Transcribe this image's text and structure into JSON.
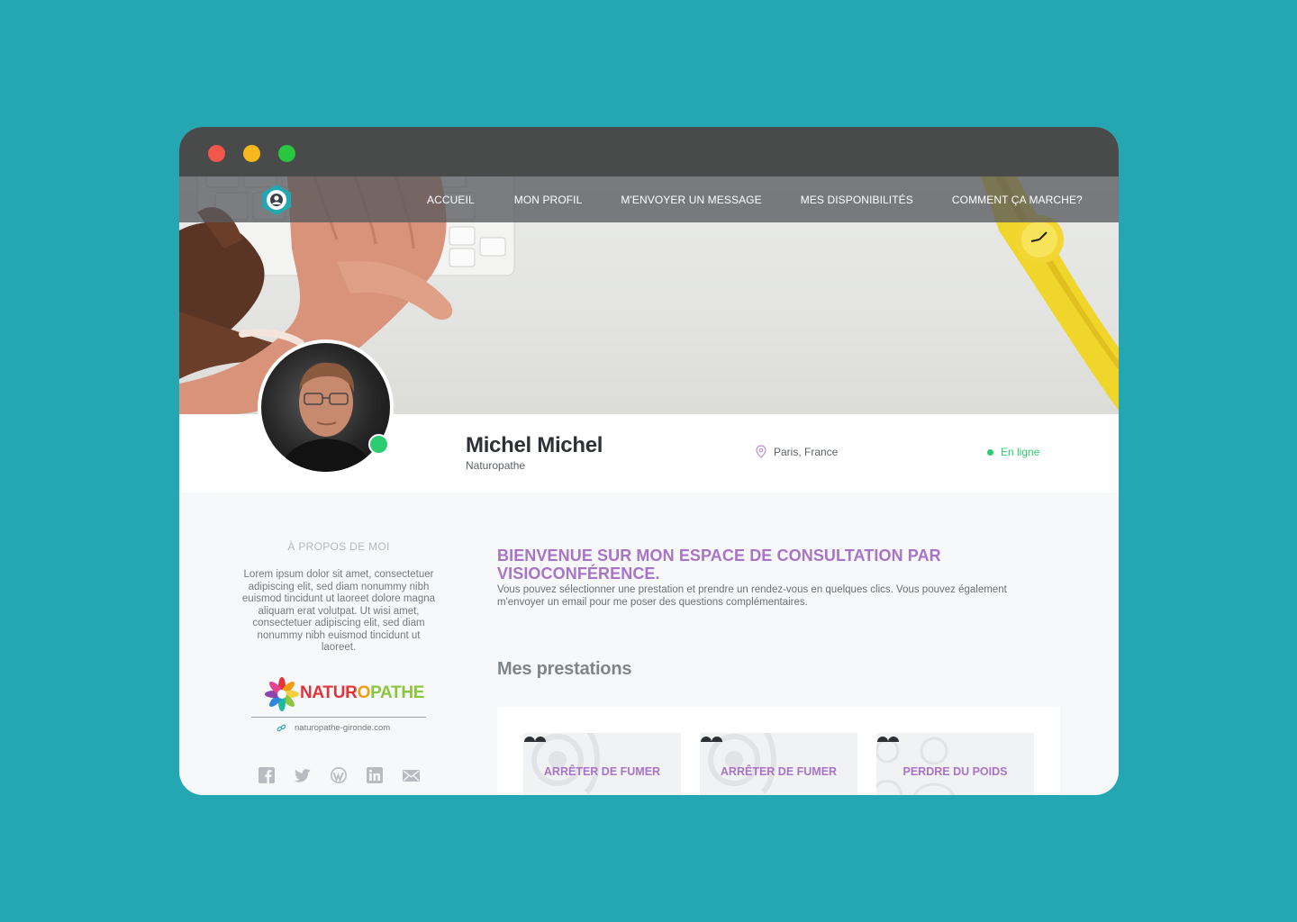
{
  "window": {
    "controls": [
      "close",
      "minimize",
      "maximize"
    ]
  },
  "nav": {
    "logo": "brand-logo-icon",
    "links": [
      "ACCUEIL",
      "MON PROFIL",
      "M'ENVOYER UN MESSAGE",
      "MES DISPONIBILITÉS",
      "COMMENT ÇA MARCHE?"
    ]
  },
  "profile": {
    "name": "Michel Michel",
    "job": "Naturopathe",
    "location": "Paris, France",
    "status": "En ligne"
  },
  "about": {
    "title": "À PROPOS DE MOI",
    "text": "Lorem ipsum dolor sit amet, consectetuer adipiscing elit, sed diam nonummy nibh euismod tincidunt ut laoreet dolore magna aliquam erat volutpat. Ut wisi amet, consectetuer adipiscing elit, sed diam nonummy nibh euismod tincidunt ut laoreet.",
    "brand_part1": "NATUR",
    "brand_part2": "O",
    "brand_part3": "PATHE",
    "website": "naturopathe-gironde.com",
    "socials": [
      "facebook-icon",
      "twitter-icon",
      "wordpress-icon",
      "linkedin-icon",
      "mail-icon"
    ]
  },
  "main": {
    "welcome_title": "BIENVENUE SUR MON ESPACE DE CONSULTATION PAR VISIOCONFÉRENCE.",
    "welcome_text": "Vous pouvez sélectionner une prestation et prendre un rendez-vous en quelques clics. Vous pouvez également m'envoyer un email pour me poser des questions complémentaires.",
    "services_title": "Mes prestations",
    "services": [
      {
        "title": "ARRÊTER DE FUMER"
      },
      {
        "title": "ARRÊTER DE FUMER"
      },
      {
        "title": "PERDRE DU POIDS"
      }
    ]
  },
  "colors": {
    "background": "#24a7b3",
    "accent": "#a874c7",
    "online": "#2ecc71",
    "titlebar": "#494b4b"
  }
}
